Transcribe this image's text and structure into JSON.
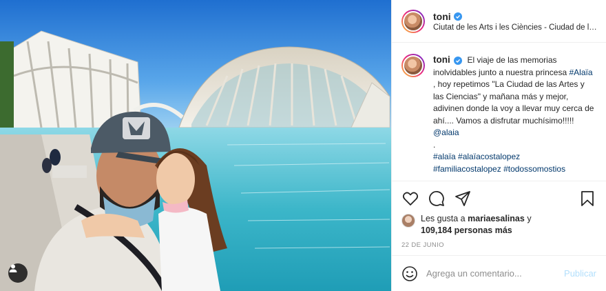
{
  "header": {
    "username": "toni",
    "location": "Ciutat de les Arts i les Ciències - Ciudad de las Artes y las Ciencias"
  },
  "caption": {
    "username": "toni",
    "text_1": "El viaje de las memorias inolvidables junto a nuestra princesa",
    "mention_1": "#Alaïa",
    "text_2": ", hoy repetimos \"La Ciudad de las Artes y las Ciencias\" y mañana más y mejor, adivinen donde la voy a llevar muy cerca de ahí.... Vamos a disfrutar muchísimo!!!!!",
    "mention_2": "@alaia",
    "dot": ".",
    "hashtags": [
      "#alaïa",
      "#alaïacostalopez",
      "#familiacostalopez",
      "#todossomostios"
    ]
  },
  "likes": {
    "prefix": "Les gusta a",
    "first_user": "mariaesalinas",
    "connector": "y",
    "count_text": "109,184 personas más"
  },
  "date": "22 DE JUNIO",
  "comment": {
    "placeholder": "Agrega un comentario...",
    "publish_label": "Publicar"
  },
  "colors": {
    "link": "#00376b",
    "verified": "#3897f0",
    "publish_disabled": "#b2dffc",
    "muted": "#8e8e8e"
  },
  "icons": [
    "heart-icon",
    "comment-icon",
    "share-icon",
    "bookmark-icon",
    "user-tag-icon",
    "verified-icon"
  ]
}
